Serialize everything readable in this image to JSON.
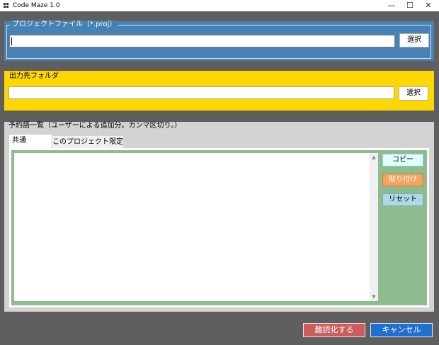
{
  "window": {
    "title": "Code Maze 1.0",
    "minimize_glyph": "—",
    "maximize_glyph": "☐",
    "close_glyph": "✕"
  },
  "project_file": {
    "legend": "プロジェクトファイル（*.proj）",
    "value": "",
    "select_label": "選択"
  },
  "output_folder": {
    "label": "出力先フォルダ",
    "value": "",
    "select_label": "選択"
  },
  "keywords": {
    "label": "予約語一覧（ユーザーによる追加分。カンマ区切り。）",
    "tabs": [
      {
        "label": "共通",
        "active": true
      },
      {
        "label": "このプロジェクト限定",
        "active": false
      }
    ],
    "text": "",
    "copy_label": "コピー",
    "paste_label": "貼り付け",
    "reset_label": "リセット"
  },
  "footer": {
    "obfuscate_label": "難読化する",
    "cancel_label": "キャンセル"
  },
  "colors": {
    "background": "#5f5f5f",
    "project_panel": "#4682b4",
    "output_panel": "#ffd700",
    "keyword_panel": "#d3d3d3",
    "keyword_area": "#8fbc8f",
    "copy_button": "#e0ffff",
    "paste_button": "#f4a460",
    "reset_button": "#add8e6",
    "obfuscate_button": "#cd5c5c",
    "cancel_button": "#1e6fd0"
  }
}
